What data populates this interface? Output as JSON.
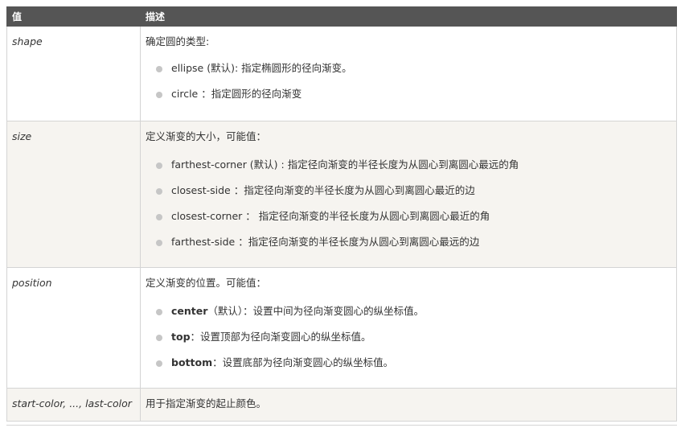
{
  "table": {
    "header": {
      "value": "值",
      "description": "描述"
    },
    "rows": [
      {
        "value": "shape",
        "intro": "确定圆的类型:",
        "options": [
          {
            "key": "",
            "text": "ellipse (默认): 指定椭圆形的径向渐变。"
          },
          {
            "key": "",
            "text": "circle ：指定圆形的径向渐变"
          }
        ]
      },
      {
        "value": "size",
        "intro": "定义渐变的大小，可能值：",
        "options": [
          {
            "key": "",
            "text": "farthest-corner (默认) : 指定径向渐变的半径长度为从圆心到离圆心最远的角"
          },
          {
            "key": "",
            "text": "closest-side ：指定径向渐变的半径长度为从圆心到离圆心最近的边"
          },
          {
            "key": "",
            "text": "closest-corner ： 指定径向渐变的半径长度为从圆心到离圆心最近的角"
          },
          {
            "key": "",
            "text": "farthest-side ：指定径向渐变的半径长度为从圆心到离圆心最远的边"
          }
        ]
      },
      {
        "value": "position",
        "intro": "定义渐变的位置。可能值：",
        "options": [
          {
            "key": "center",
            "text": "（默认）：设置中间为径向渐变圆心的纵坐标值。"
          },
          {
            "key": "top",
            "text": "：设置顶部为径向渐变圆心的纵坐标值。"
          },
          {
            "key": "bottom",
            "text": "：设置底部为径向渐变圆心的纵坐标值。"
          }
        ]
      },
      {
        "value": "start-color, ..., last-color",
        "intro": "用于指定渐变的起止颜色。",
        "options": []
      }
    ]
  },
  "colors": {
    "header_bg": "#555555",
    "alt_row_bg": "#f6f4f0",
    "border": "#d4d4d4",
    "bullet": "#c6c6c6"
  }
}
